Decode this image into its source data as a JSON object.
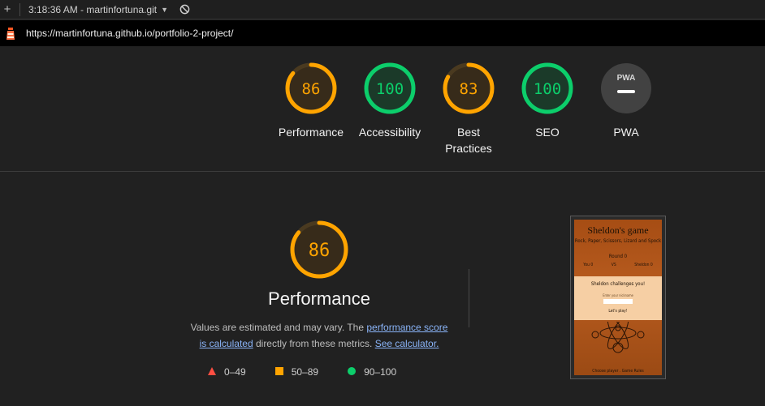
{
  "topbar": {
    "plus_icon": "plus-icon",
    "tab_title": "3:18:36 AM - martinfortuna.git",
    "caret_icon": "caret-down-icon",
    "block_icon": "no-entry-icon"
  },
  "urlbar": {
    "url": "https://martinfortuna.github.io/portfolio-2-project/",
    "site_icon": "lighthouse-icon"
  },
  "gauges": [
    {
      "label": "Performance",
      "score": "86",
      "color": "#ffa400"
    },
    {
      "label": "Accessibility",
      "score": "100",
      "color": "#0cce6b"
    },
    {
      "label": "Best Practices",
      "score": "83",
      "color": "#ffa400"
    },
    {
      "label": "SEO",
      "score": "100",
      "color": "#0cce6b"
    },
    {
      "label": "PWA",
      "score": "",
      "badge": "PWA",
      "color": "#9e9e9e"
    }
  ],
  "main": {
    "score": "86",
    "score_value": 0.86,
    "title": "Performance",
    "desc_prefix": "Values are estimated and may vary. The ",
    "link_score": "performance score is calculated",
    "desc_mid": " directly from these metrics. ",
    "link_calc": "See calculator."
  },
  "legend": [
    {
      "range": "0–49",
      "shape": "triangle",
      "color": "#ff4e42"
    },
    {
      "range": "50–89",
      "shape": "square",
      "color": "#ffa400"
    },
    {
      "range": "90–100",
      "shape": "circle",
      "color": "#0cce6b"
    }
  ],
  "screenshot": {
    "title": "Sheldon's game",
    "subtitle": "Rock, Paper, Scissors, Lizard and Spock",
    "round": "Round 0",
    "you": "You 0",
    "vs": "VS",
    "sheldon": "Sheldon 0",
    "challenge": "Sheldon challenges you!",
    "nickname": "Enter your nickname",
    "play": "Let's play!",
    "footer": "Choose player . Game Rules"
  },
  "colors": {
    "good": "#0cce6b",
    "average": "#ffa400",
    "bad": "#ff4e42",
    "link": "#8ab4f8"
  }
}
